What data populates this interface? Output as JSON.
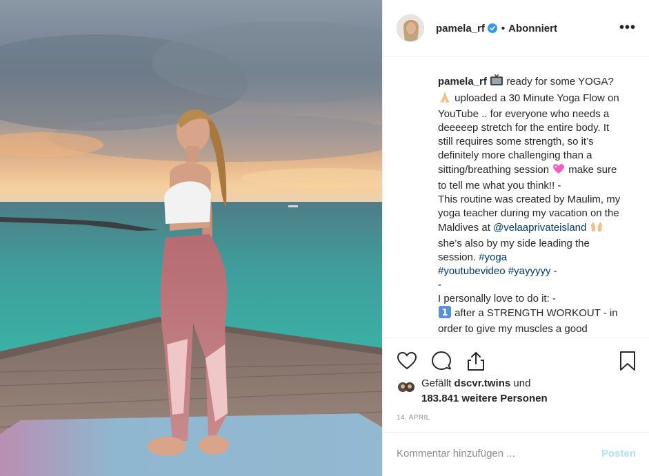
{
  "post": {
    "image_alt": "photo",
    "author": {
      "username": "pamela_rf",
      "verified": true,
      "follow_status": "Abonniert"
    },
    "menu_icon": "more-horizontal-icon",
    "caption": {
      "username": "pamela_rf",
      "part1": " ready for some YOGA? ",
      "part2": " uploaded a 30 Minute Yoga Flow on YouTube .. for everyone who needs a deeeeep stretch for the entire body. It still requires some strength, so it’s definitely more challenging than a sitting/breathing session ",
      "part3": " make sure to tell me what you think!! -\nThis routine was created by Maulim, my yoga teacher during my vacation on the Maldives at ",
      "mention": "@velaaprivateisland",
      "part4": " she’s also by my side leading the session. ",
      "hashtag1": "#yoga",
      "hashtag2": "#youtubevideo",
      "hashtag3": "#yayyyyy",
      "part5": " -\n-\nI personally love to do it: -\n",
      "part6": " after a STRENGTH WORKOUT - in order to give my muscles a good",
      "emojis": [
        "tv-emoji",
        "folded-hands-emoji",
        "pink-heart-emoji",
        "raised-hands-emoji",
        "keycap-1-emoji"
      ]
    },
    "actions": {
      "like_icon": "heart-icon",
      "comment_icon": "comment-icon",
      "share_icon": "share-icon",
      "save_icon": "bookmark-icon"
    },
    "likes": {
      "prefix": "Gefällt",
      "user": "dscvr.twins",
      "suffix": "und",
      "count_text": "183.841 weitere Personen"
    },
    "date": "14. APRIL",
    "comment_box": {
      "placeholder": "Kommentar hinzufügen ...",
      "post_label": "Posten"
    },
    "colors": {
      "text": "#262626",
      "link": "#003569",
      "muted": "#8e8e8e",
      "verified_blue": "#3897f0",
      "post_disabled": "#b2dffc",
      "border": "#efefef"
    }
  }
}
